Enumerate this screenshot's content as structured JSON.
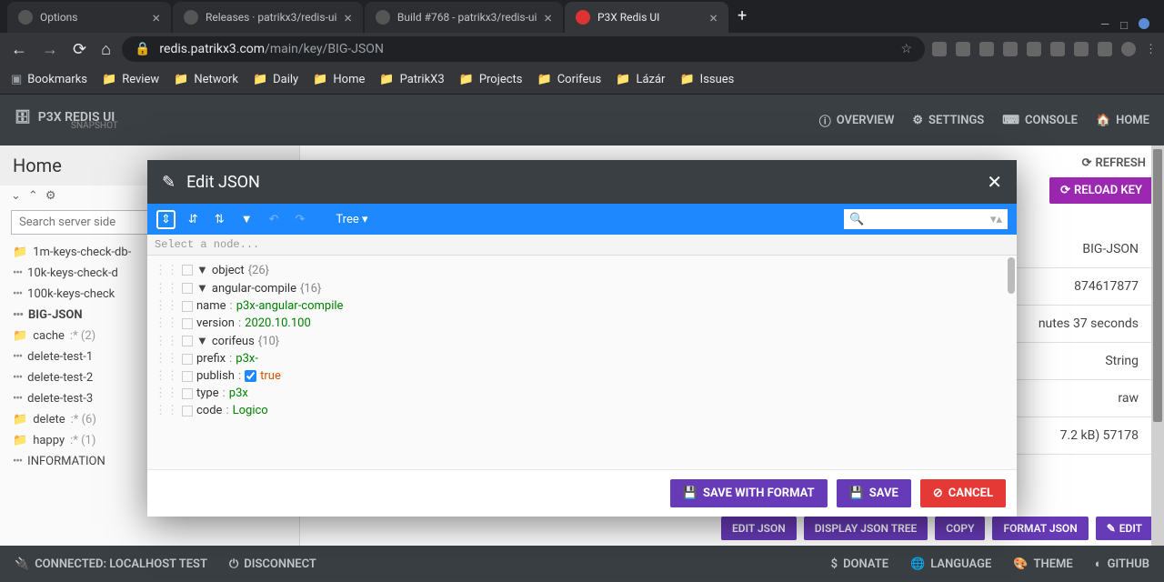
{
  "browser": {
    "tabs": [
      {
        "title": "Options"
      },
      {
        "title": "Releases · patrikx3/redis-ui"
      },
      {
        "title": "Build #768 - patrikx3/redis-ui"
      },
      {
        "title": "P3X Redis UI",
        "active": true
      }
    ],
    "url_prefix": "redis.patrikx3.com",
    "url_path": "/main/key/BIG-JSON",
    "bookmarks": [
      "Bookmarks",
      "Review",
      "Network",
      "Daily",
      "Home",
      "PatrikX3",
      "Projects",
      "Corifeus",
      "Lázár",
      "Issues"
    ]
  },
  "app": {
    "title": "P3X REDIS UI",
    "subtitle": "SNAPSHOT",
    "nav": {
      "overview": "OVERVIEW",
      "settings": "SETTINGS",
      "console": "CONSOLE",
      "home": "HOME"
    }
  },
  "sidebar": {
    "title": "Home",
    "search_placeholder": "Search server side",
    "items": [
      {
        "type": "folder",
        "label": "1m-keys-check-db-",
        "suffix": ""
      },
      {
        "type": "key",
        "label": "10k-keys-check-d",
        "suffix": ""
      },
      {
        "type": "key",
        "label": "100k-keys-check",
        "suffix": ""
      },
      {
        "type": "key",
        "label": "BIG-JSON",
        "selected": true
      },
      {
        "type": "folder",
        "label": "cache",
        "suffix": ":* (2)"
      },
      {
        "type": "key",
        "label": "delete-test-1"
      },
      {
        "type": "key",
        "label": "delete-test-2"
      },
      {
        "type": "key",
        "label": "delete-test-3"
      },
      {
        "type": "folder",
        "label": "delete",
        "suffix": ":* (6)"
      },
      {
        "type": "folder",
        "label": "happy",
        "suffix": ":* (1)"
      },
      {
        "type": "key",
        "label": "INFORMATION"
      }
    ]
  },
  "content": {
    "refresh": "REFRESH",
    "reload_key": "RELOAD KEY",
    "rows": {
      "key": "BIG-JSON",
      "id": "874617877",
      "ttl": "nutes 37 seconds",
      "type": "String",
      "encoding": "raw",
      "size": "7.2 kB)  57178"
    },
    "actions": {
      "edit_json": "EDIT JSON",
      "display_tree": "DISPLAY JSON TREE",
      "copy": "COPY",
      "format": "FORMAT JSON",
      "edit": "EDIT"
    }
  },
  "dialog": {
    "title": "Edit JSON",
    "mode": "Tree ▾",
    "path_placeholder": "Select a node...",
    "save_format": "SAVE WITH FORMAT",
    "save": "SAVE",
    "cancel": "CANCEL",
    "tree": {
      "root": "object",
      "root_count": "{26}",
      "lines": [
        {
          "indent": 1,
          "caret": "▼",
          "key": "angular-compile",
          "count": "{16}"
        },
        {
          "indent": 2,
          "key": "name",
          "sep": ":",
          "val": "p3x-angular-compile",
          "cls": "json-str"
        },
        {
          "indent": 2,
          "key": "version",
          "sep": ":",
          "val": "2020.10.100",
          "cls": "json-str"
        },
        {
          "indent": 2,
          "caret": "▼",
          "key": "corifeus",
          "count": "{10}"
        },
        {
          "indent": 3,
          "key": "prefix",
          "sep": ":",
          "val": "p3x-",
          "cls": "json-str"
        },
        {
          "indent": 3,
          "key": "publish",
          "sep": ":",
          "val": "true",
          "cls": "json-bool",
          "checkbox": true
        },
        {
          "indent": 3,
          "key": "type",
          "sep": ":",
          "val": "p3x",
          "cls": "json-str"
        },
        {
          "indent": 3,
          "key": "code",
          "sep": ":",
          "val": "Logico",
          "cls": "json-str"
        }
      ]
    }
  },
  "footer": {
    "connected": "CONNECTED: LOCALHOST TEST",
    "disconnect": "DISCONNECT",
    "donate": "DONATE",
    "language": "LANGUAGE",
    "theme": "THEME",
    "github": "GITHUB"
  }
}
